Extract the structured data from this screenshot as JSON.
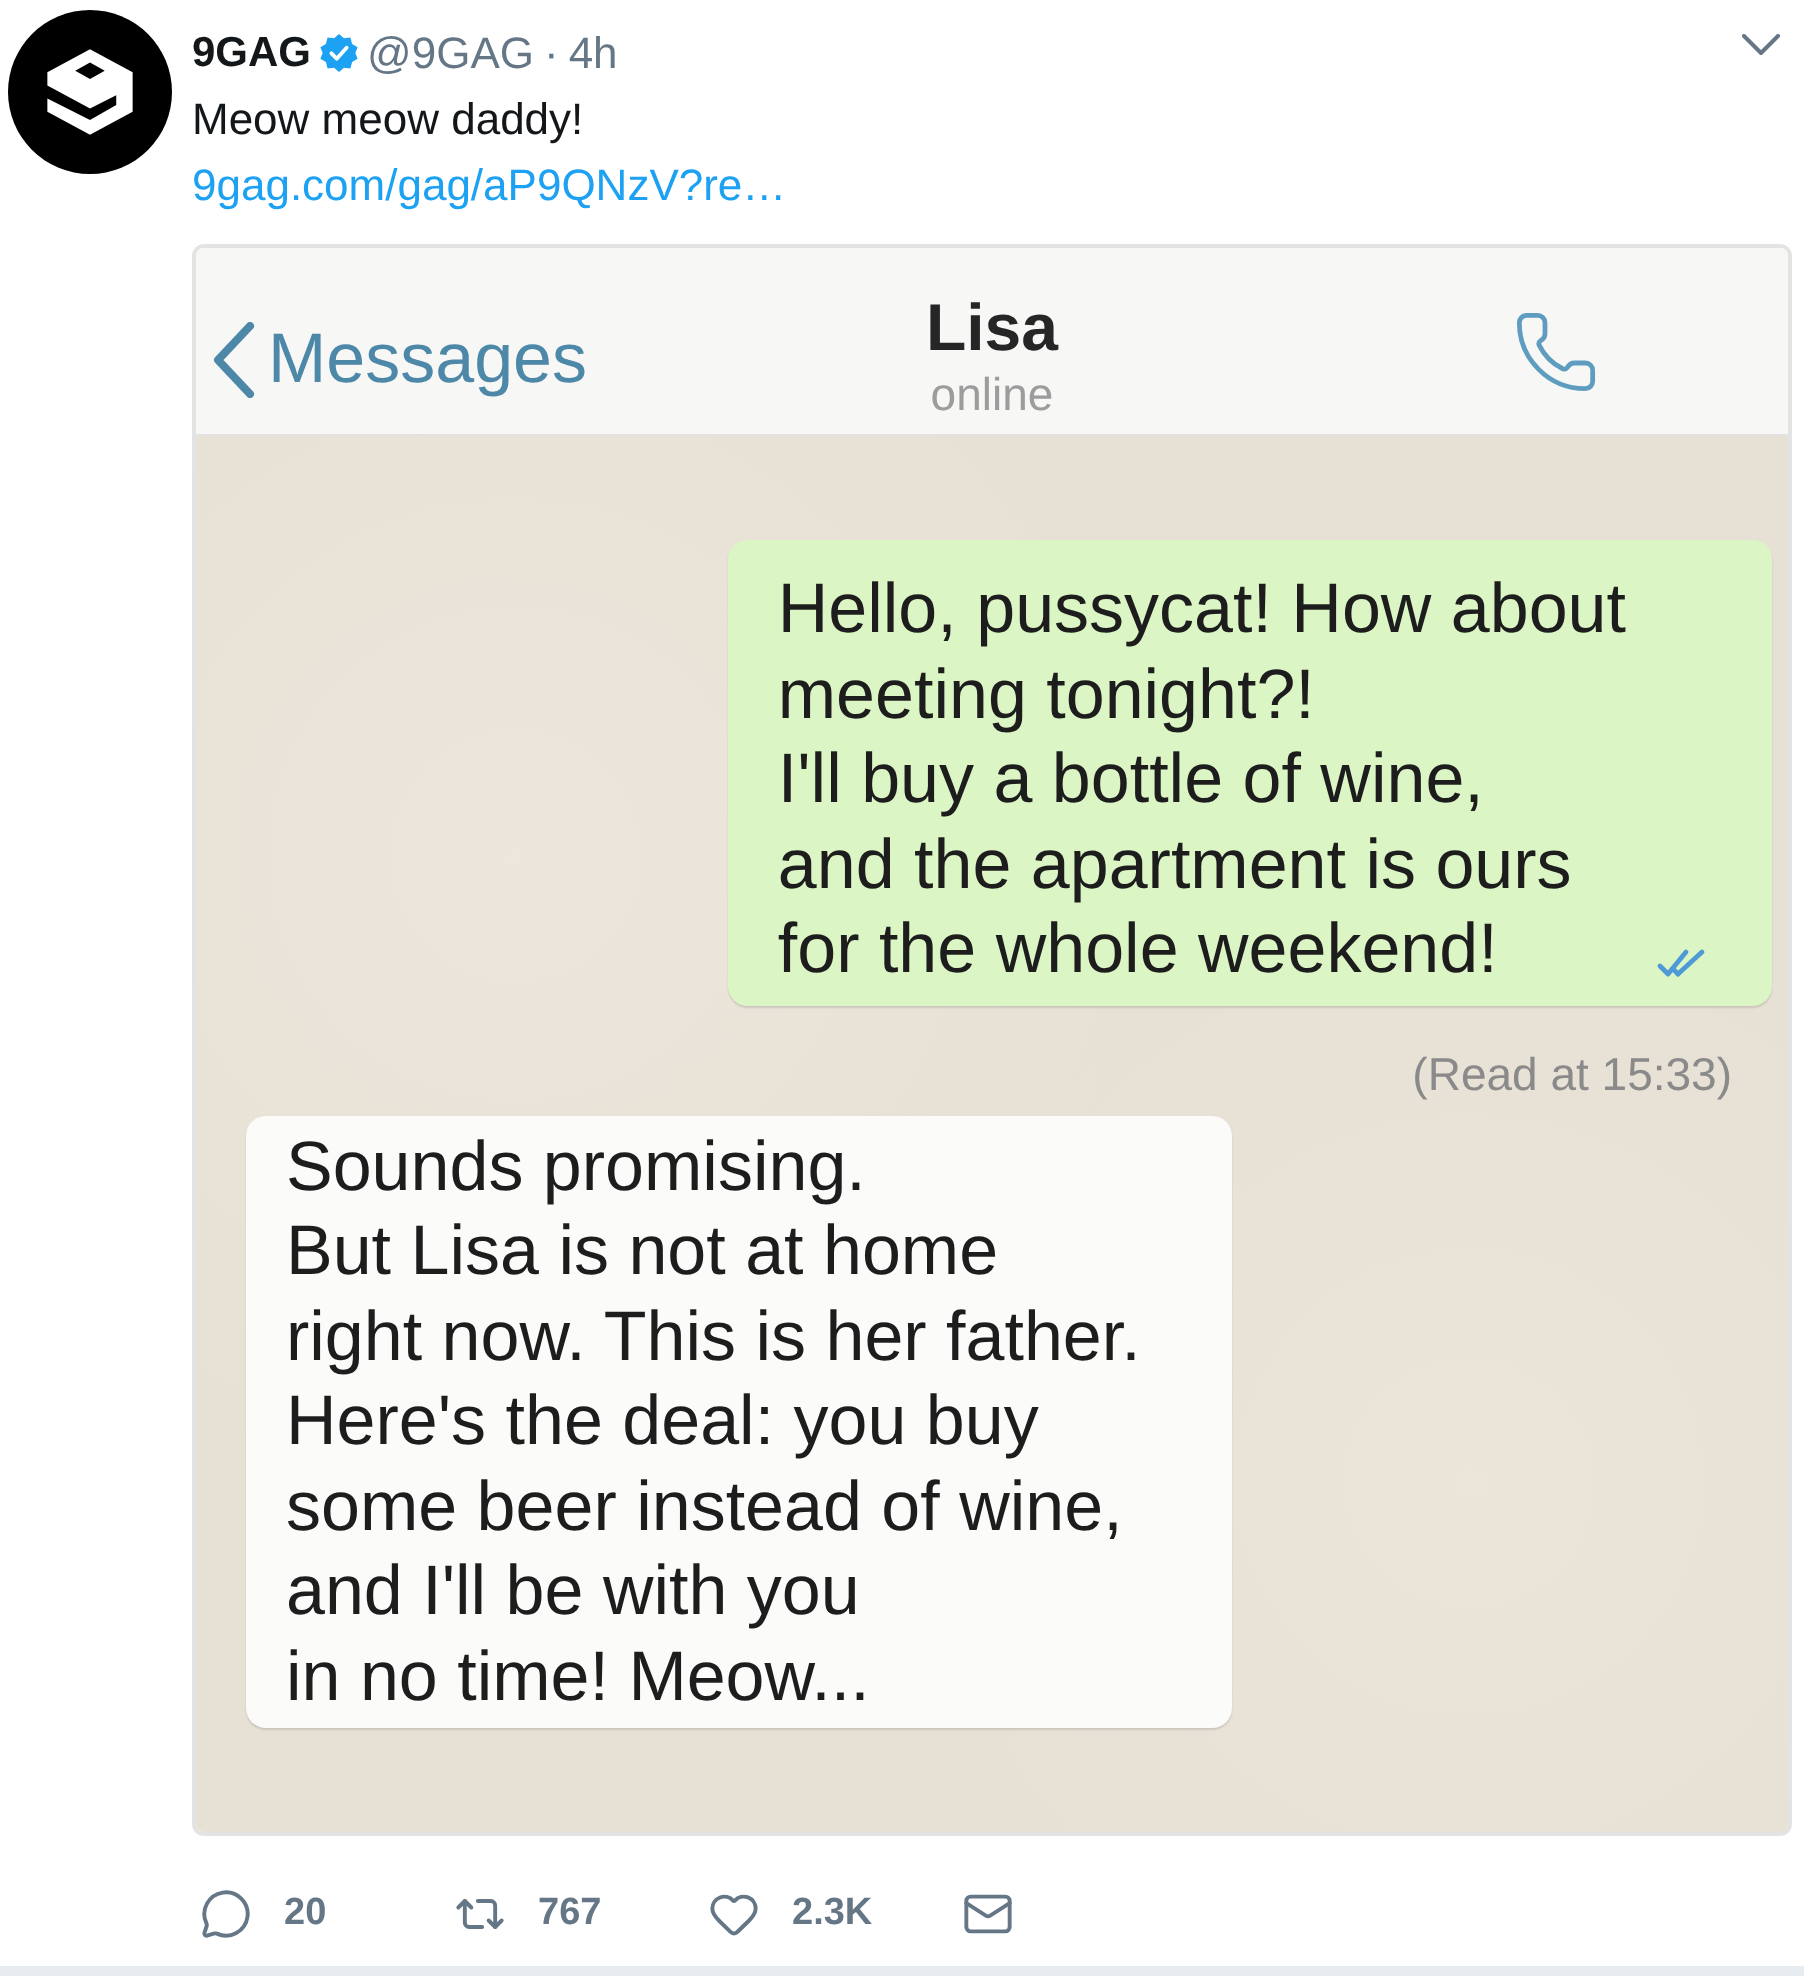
{
  "tweet": {
    "author": {
      "name": "9GAG",
      "verified": true,
      "handle": "@9GAG",
      "separator": "·",
      "time": "4h"
    },
    "text": "Meow meow daddy!",
    "link": "9gag.com/gag/aP9QNzV?re…"
  },
  "chat_screenshot": {
    "header": {
      "back_label": "Messages",
      "contact": "Lisa",
      "status": "online"
    },
    "messages": [
      {
        "kind": "outgoing",
        "text": "Hello, pussycat! How about\nmeeting tonight?!\nI'll buy a bottle of wine,\nand the apartment is ours\nfor the whole weekend!",
        "read": true
      },
      {
        "kind": "receipt",
        "text": "(Read at 15:33)"
      },
      {
        "kind": "incoming",
        "text": "Sounds promising.\nBut Lisa is not at home\nright now. This is her father.\nHere's the deal: you buy\nsome beer instead of wine,\nand I'll be with you\nin no time! Meow..."
      }
    ]
  },
  "actions": [
    {
      "kind": "reply",
      "count": "20"
    },
    {
      "kind": "retweet",
      "count": "767"
    },
    {
      "kind": "like",
      "count": "2.3K"
    },
    {
      "kind": "message"
    }
  ]
}
